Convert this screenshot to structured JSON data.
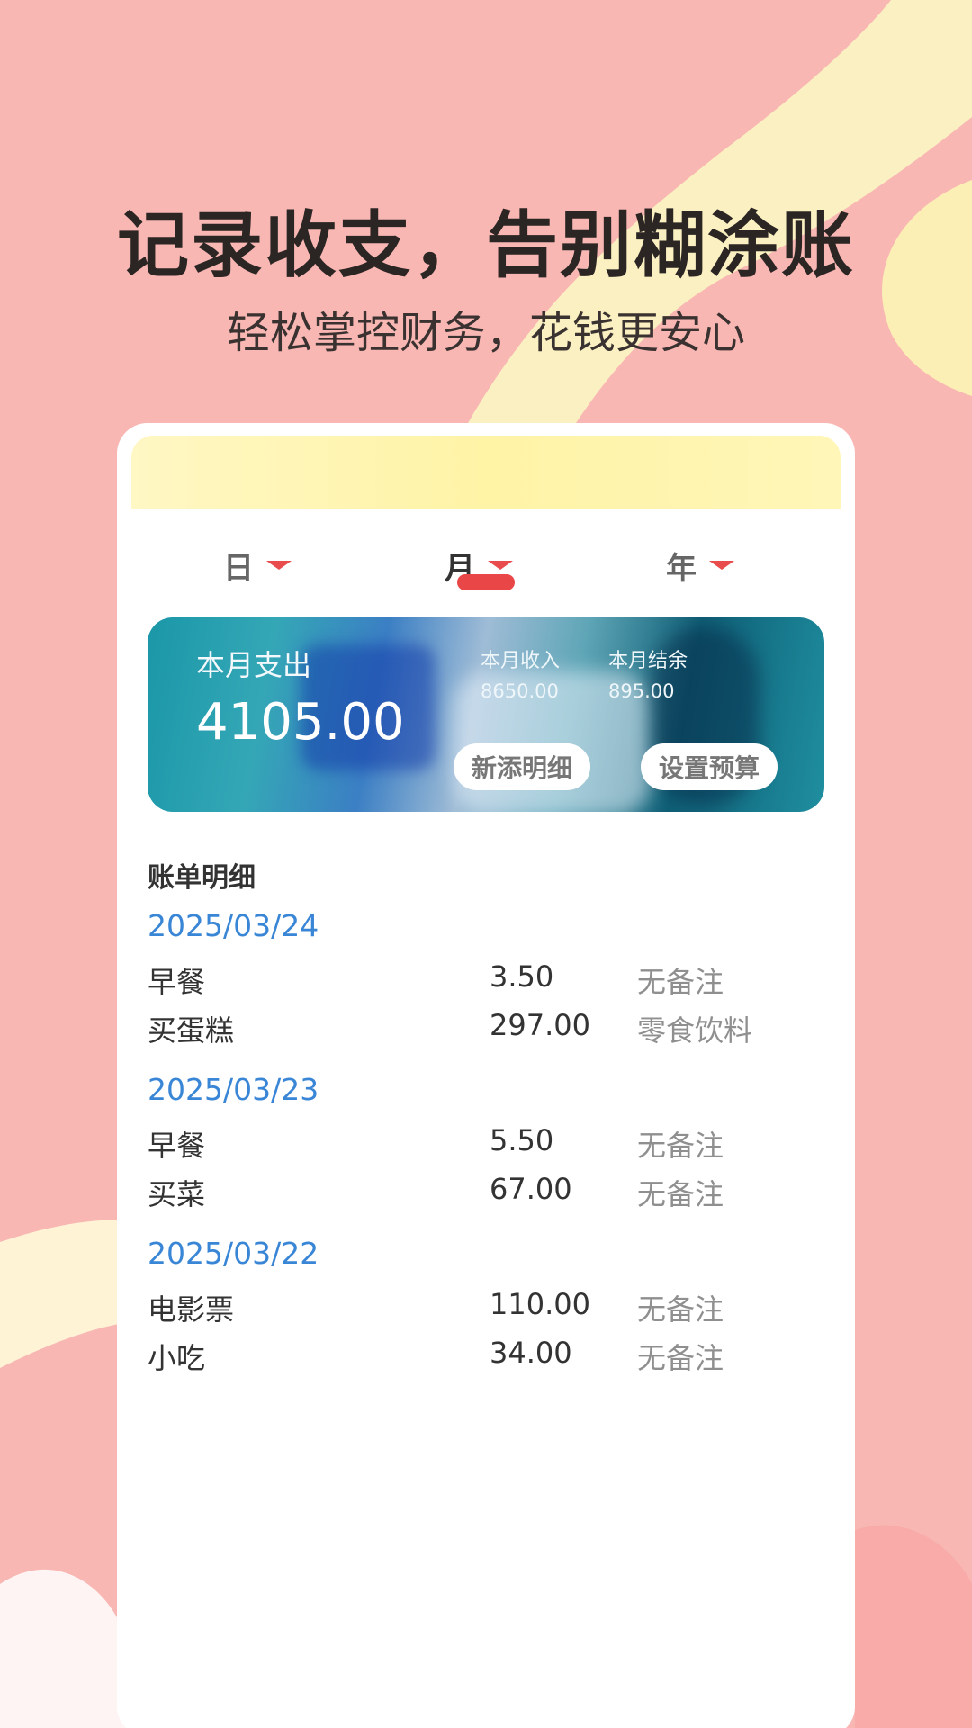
{
  "colors": {
    "background": "#f9b7b4",
    "accent_red": "#e94747",
    "date_blue": "#3a86d6",
    "ribbon_yellow": "#fff3a6"
  },
  "promo": {
    "headline": "记录收支，告别糊涂账",
    "subline": "轻松掌控财务，花钱更安心"
  },
  "tabs": [
    {
      "label": "日",
      "active": false
    },
    {
      "label": "月",
      "active": true
    },
    {
      "label": "年",
      "active": false
    }
  ],
  "summary": {
    "expense_label": "本月支出",
    "expense_value": "4105.00",
    "income_label": "本月收入",
    "income_value": "8650.00",
    "balance_label": "本月结余",
    "balance_value": "895.00",
    "add_button": "新添明细",
    "budget_button": "设置预算"
  },
  "bills": {
    "title": "账单明细",
    "days": [
      {
        "date": "2025/03/24",
        "items": [
          {
            "name": "早餐",
            "amount": "3.50",
            "note": "无备注"
          },
          {
            "name": "买蛋糕",
            "amount": "297.00",
            "note": "零食饮料"
          }
        ]
      },
      {
        "date": "2025/03/23",
        "items": [
          {
            "name": "早餐",
            "amount": "5.50",
            "note": "无备注"
          },
          {
            "name": "买菜",
            "amount": "67.00",
            "note": "无备注"
          }
        ]
      },
      {
        "date": "2025/03/22",
        "items": [
          {
            "name": "电影票",
            "amount": "110.00",
            "note": "无备注"
          },
          {
            "name": "小吃",
            "amount": "34.00",
            "note": "无备注"
          }
        ]
      }
    ]
  }
}
